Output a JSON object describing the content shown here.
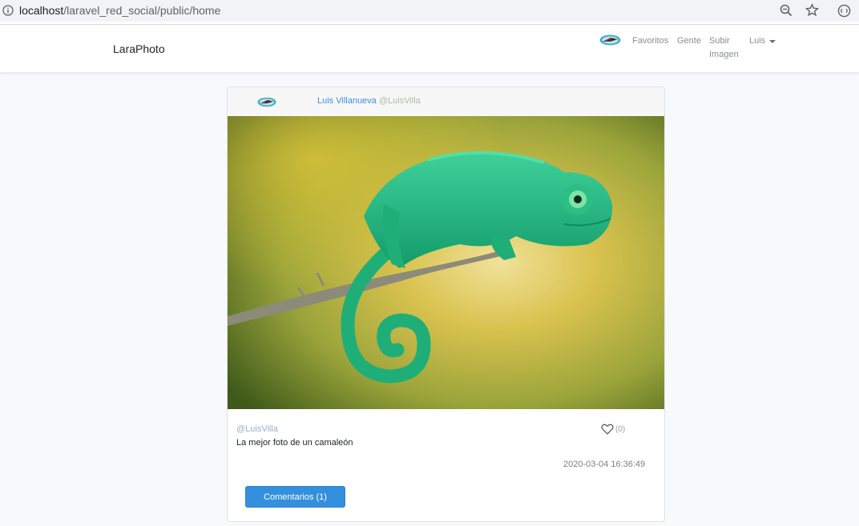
{
  "browser": {
    "url_host": "localhost",
    "url_path": "/laravel_red_social/public/home"
  },
  "navbar": {
    "brand": "LaraPhoto",
    "links": {
      "favoritos": "Favoritos",
      "gente": "Gente",
      "subir_imagen": "Subir Imagen"
    },
    "user": "Luis"
  },
  "post": {
    "author_name": "Luis Villanueva",
    "author_nick": "@LuisVilla",
    "caption_nick": "@LuisVilla",
    "description": "La mejor foto de un camaleón",
    "likes": "(0)",
    "date": "2020-03-04 16:36:49",
    "comments_button": "Comentarios (1)"
  },
  "colors": {
    "primary": "#3490dc",
    "link": "#3d8fd8",
    "nick": "#a7bfa0"
  }
}
